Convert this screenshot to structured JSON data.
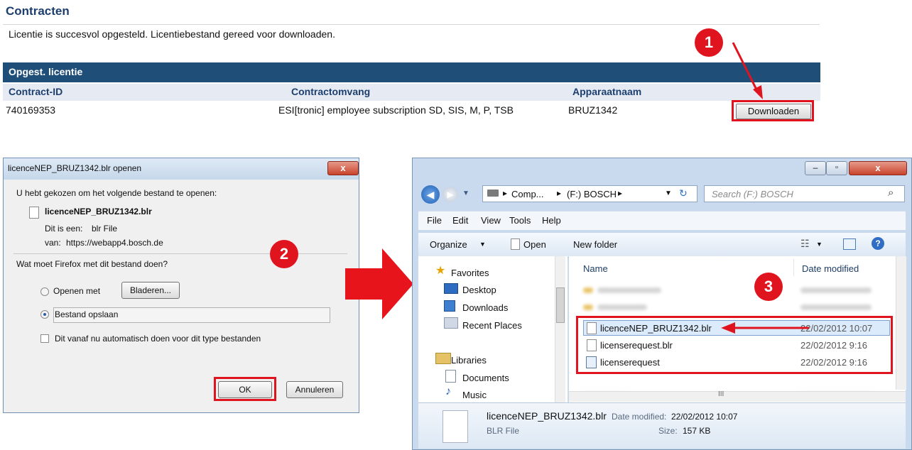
{
  "web": {
    "title": "Contracten",
    "message": "Licentie is succesvol opgesteld. Licentiebestand gereed voor downloaden.",
    "section_title": "Opgest. licentie",
    "columns": [
      "Contract-ID",
      "Contractomvang",
      "Apparaatnaam"
    ],
    "row": {
      "contract_id": "740169353",
      "scope": "ESI[tronic] employee subscription SD, SIS, M, P, TSB",
      "device": "BRUZ1342"
    },
    "download_label": "Downloaden"
  },
  "steps": [
    "1",
    "2",
    "3"
  ],
  "dialog": {
    "title": "licenceNEP_BRUZ1342.blr openen",
    "close": "x",
    "intro": "U hebt gekozen om het volgende bestand te openen:",
    "filename": "licenceNEP_BRUZ1342.blr",
    "type_label": "Dit is een:",
    "type_value": "blr File",
    "from_label": "van:",
    "from_value": "https://webapp4.bosch.de",
    "question": "Wat moet Firefox met dit bestand doen?",
    "open_with": "Openen met",
    "browse": "Bladeren...",
    "save_file": "Bestand opslaan",
    "auto": "Dit vanaf nu automatisch doen voor dit type bestanden",
    "ok": "OK",
    "cancel": "Annuleren"
  },
  "explorer": {
    "breadcrumb": [
      "Comp...",
      "(F:) BOSCH"
    ],
    "search_placeholder": "Search (F:) BOSCH",
    "menu": [
      "File",
      "Edit",
      "View",
      "Tools",
      "Help"
    ],
    "organize": "Organize",
    "open": "Open",
    "new_folder": "New folder",
    "favorites": "Favorites",
    "nav": [
      "Desktop",
      "Downloads",
      "Recent Places"
    ],
    "libraries": "Libraries",
    "lib_items": [
      "Documents",
      "Music"
    ],
    "col_name": "Name",
    "col_date": "Date modified",
    "files": [
      {
        "name": "licenceNEP_BRUZ1342.blr",
        "date": "22/02/2012 10:07"
      },
      {
        "name": "licenserequest.blr",
        "date": "22/02/2012 9:16"
      },
      {
        "name": "licenserequest",
        "date": "22/02/2012 9:16"
      }
    ],
    "scroll_marker": "III",
    "detail_name": "licenceNEP_BRUZ1342.blr",
    "detail_date_label": "Date modified:",
    "detail_date": "22/02/2012 10:07",
    "detail_type": "BLR File",
    "detail_size_label": "Size:",
    "detail_size": "157 KB"
  },
  "colors": {
    "accent_red": "#e0141e",
    "header_blue": "#1f4e79"
  }
}
